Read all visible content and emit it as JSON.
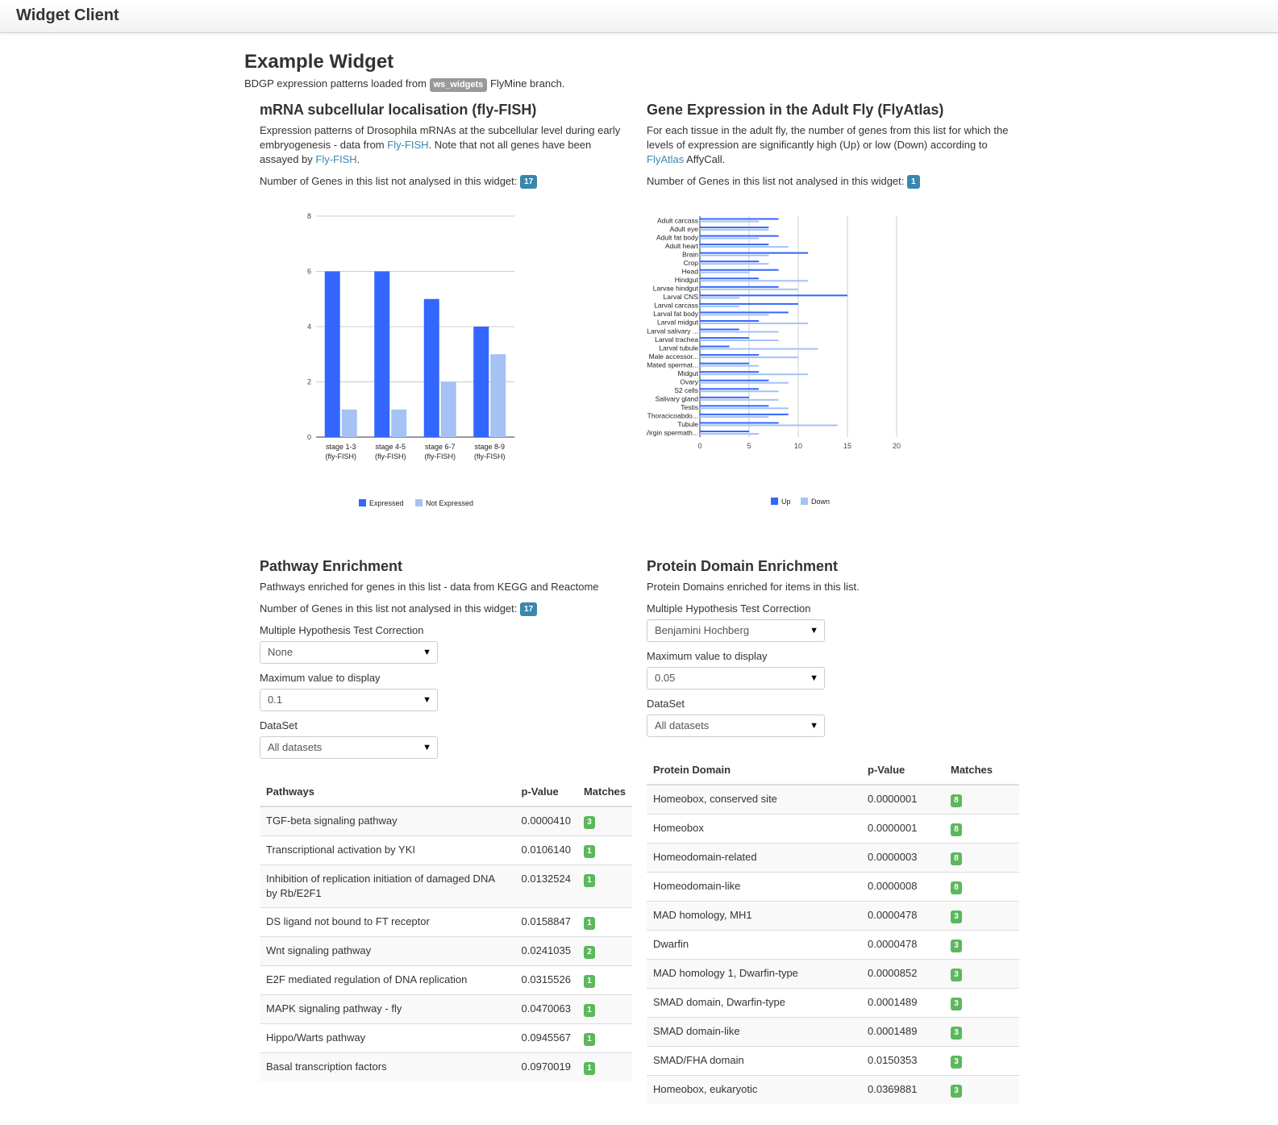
{
  "app": {
    "title": "Widget Client"
  },
  "page": {
    "title": "Example Widget",
    "intro_before": "BDGP expression patterns loaded from",
    "branch_label": "ws_widgets",
    "intro_after": "FlyMine branch."
  },
  "flyfish": {
    "title": "mRNA subcellular localisation (fly-FISH)",
    "desc_1": "Expression patterns of Drosophila mRNAs at the subcellular level during early embryogenesis - data from",
    "link_1": "Fly-FISH",
    "desc_2": ". Note that not all genes have been assayed by",
    "link_2": "Fly-FISH",
    "desc_3": ".",
    "not_analysed_label": "Number of Genes in this list not analysed in this widget:",
    "not_analysed_count": "17"
  },
  "flyatlas": {
    "title": "Gene Expression in the Adult Fly (FlyAtlas)",
    "desc_1": "For each tissue in the adult fly, the number of genes from this list for which the levels of expression are significantly high (Up) or low (Down) according to",
    "link_1": "FlyAtlas",
    "desc_2": " AffyCall.",
    "not_analysed_label": "Number of Genes in this list not analysed in this widget:",
    "not_analysed_count": "1"
  },
  "pathway": {
    "title": "Pathway Enrichment",
    "desc": "Pathways enriched for genes in this list - data from KEGG and Reactome",
    "not_analysed_label": "Number of Genes in this list not analysed in this widget:",
    "not_analysed_count": "17",
    "correction_label": "Multiple Hypothesis Test Correction",
    "correction_value": "None",
    "max_label": "Maximum value to display",
    "max_value": "0.1",
    "dataset_label": "DataSet",
    "dataset_value": "All datasets",
    "columns": {
      "name": "Pathways",
      "pvalue": "p-Value",
      "matches": "Matches"
    },
    "rows": [
      {
        "name": "TGF-beta signaling pathway",
        "pvalue": "0.0000410",
        "matches": "3"
      },
      {
        "name": "Transcriptional activation by YKI",
        "pvalue": "0.0106140",
        "matches": "1"
      },
      {
        "name": "Inhibition of replication initiation of damaged DNA by Rb/E2F1",
        "pvalue": "0.0132524",
        "matches": "1"
      },
      {
        "name": "DS ligand not bound to FT receptor",
        "pvalue": "0.0158847",
        "matches": "1"
      },
      {
        "name": "Wnt signaling pathway",
        "pvalue": "0.0241035",
        "matches": "2"
      },
      {
        "name": "E2F mediated regulation of DNA replication",
        "pvalue": "0.0315526",
        "matches": "1"
      },
      {
        "name": "MAPK signaling pathway - fly",
        "pvalue": "0.0470063",
        "matches": "1"
      },
      {
        "name": "Hippo/Warts pathway",
        "pvalue": "0.0945567",
        "matches": "1"
      },
      {
        "name": "Basal transcription factors",
        "pvalue": "0.0970019",
        "matches": "1"
      }
    ]
  },
  "protein": {
    "title": "Protein Domain Enrichment",
    "desc": "Protein Domains enriched for items in this list.",
    "correction_label": "Multiple Hypothesis Test Correction",
    "correction_value": "Benjamini Hochberg",
    "max_label": "Maximum value to display",
    "max_value": "0.05",
    "dataset_label": "DataSet",
    "dataset_value": "All datasets",
    "columns": {
      "name": "Protein Domain",
      "pvalue": "p-Value",
      "matches": "Matches"
    },
    "rows": [
      {
        "name": "Homeobox, conserved site",
        "pvalue": "0.0000001",
        "matches": "8"
      },
      {
        "name": "Homeobox",
        "pvalue": "0.0000001",
        "matches": "8"
      },
      {
        "name": "Homeodomain-related",
        "pvalue": "0.0000003",
        "matches": "8"
      },
      {
        "name": "Homeodomain-like",
        "pvalue": "0.0000008",
        "matches": "8"
      },
      {
        "name": "MAD homology, MH1",
        "pvalue": "0.0000478",
        "matches": "3"
      },
      {
        "name": "Dwarfin",
        "pvalue": "0.0000478",
        "matches": "3"
      },
      {
        "name": "MAD homology 1, Dwarfin-type",
        "pvalue": "0.0000852",
        "matches": "3"
      },
      {
        "name": "SMAD domain, Dwarfin-type",
        "pvalue": "0.0001489",
        "matches": "3"
      },
      {
        "name": "SMAD domain-like",
        "pvalue": "0.0001489",
        "matches": "3"
      },
      {
        "name": "SMAD/FHA domain",
        "pvalue": "0.0150353",
        "matches": "3"
      },
      {
        "name": "Homeobox, eukaryotic",
        "pvalue": "0.0369881",
        "matches": "3"
      }
    ]
  },
  "colors": {
    "primary_series": "#3366ff",
    "secondary_series": "#a4c2f4",
    "badge_blue": "#3a87ad",
    "badge_green": "#5cb85c",
    "link": "#3a87ad"
  },
  "chart_data": [
    {
      "type": "bar",
      "categories": [
        "stage 1-3 (fly-FISH)",
        "stage 4-5 (fly-FISH)",
        "stage 6-7 (fly-FISH)",
        "stage 8-9 (fly-FISH)"
      ],
      "category_lines": [
        [
          "stage 1-3",
          "(fly-FISH)"
        ],
        [
          "stage 4-5",
          "(fly-FISH)"
        ],
        [
          "stage 6-7",
          "(fly-FISH)"
        ],
        [
          "stage 8-9",
          "(fly-FISH)"
        ]
      ],
      "series": [
        {
          "name": "Expressed",
          "values": [
            6,
            6,
            5,
            4
          ]
        },
        {
          "name": "Not Expressed",
          "values": [
            1,
            1,
            2,
            3
          ]
        }
      ],
      "ylim": [
        0,
        8
      ],
      "yticks": [
        0,
        2,
        4,
        6,
        8
      ],
      "title": "",
      "xlabel": "",
      "ylabel": "",
      "grid": true,
      "legend": "bottom"
    },
    {
      "type": "bar",
      "orientation": "horizontal",
      "categories": [
        "Adult carcass",
        "Adult eye",
        "Adult fat body",
        "Adult heart",
        "Brain",
        "Crop",
        "Head",
        "Hindgut",
        "Larvae hindgut",
        "Larval CNS",
        "Larval carcass",
        "Larval fat body",
        "Larval midgut",
        "Larval salivary ...",
        "Larval trachea",
        "Larval tubule",
        "Male accessor...",
        "Mated spermat...",
        "Midgut",
        "Ovary",
        "S2 cells",
        "Salivary gland",
        "Testis",
        "Thoracicoabdo...",
        "Tubule",
        "Virgin spermath..."
      ],
      "series": [
        {
          "name": "Up",
          "values": [
            8,
            7,
            8,
            7,
            11,
            6,
            8,
            6,
            8,
            15,
            10,
            9,
            6,
            4,
            5,
            3,
            6,
            5,
            6,
            7,
            6,
            5,
            7,
            9,
            8,
            5
          ]
        },
        {
          "name": "Down",
          "values": [
            6,
            7,
            6,
            9,
            7,
            7,
            5,
            11,
            10,
            4,
            4,
            7,
            11,
            8,
            8,
            12,
            10,
            6,
            11,
            9,
            8,
            8,
            9,
            7,
            14,
            6
          ]
        }
      ],
      "xlim": [
        0,
        20
      ],
      "xticks": [
        0,
        5,
        10,
        15,
        20
      ],
      "title": "",
      "xlabel": "",
      "ylabel": "",
      "grid": true,
      "legend": "bottom"
    }
  ]
}
